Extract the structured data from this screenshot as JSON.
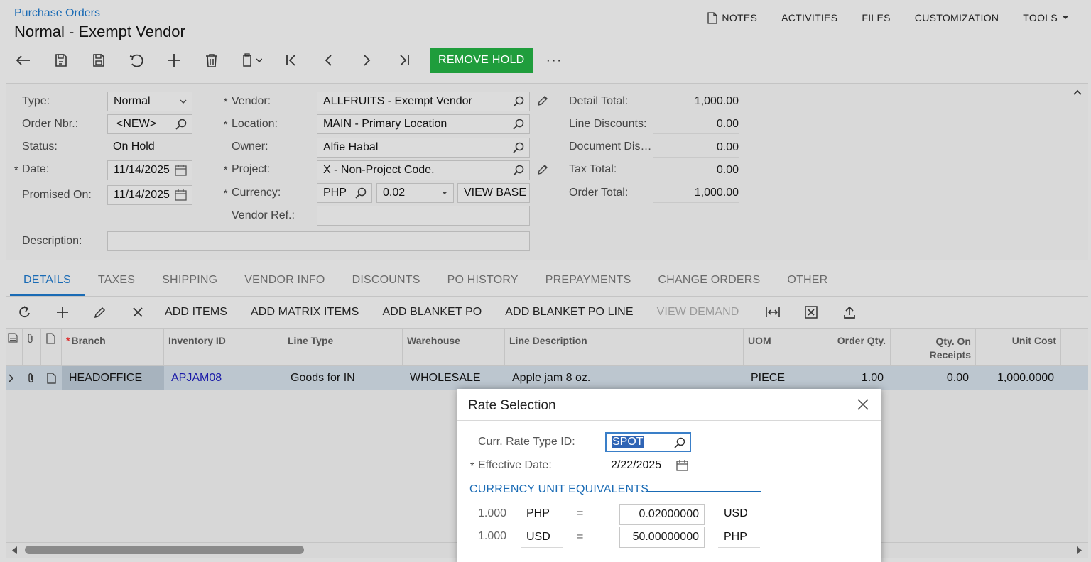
{
  "header": {
    "breadcrumb": "Purchase Orders",
    "title": "Normal - Exempt Vendor",
    "links": [
      "NOTES",
      "ACTIVITIES",
      "FILES",
      "CUSTOMIZATION",
      "TOOLS"
    ]
  },
  "toolbar": {
    "remove_hold": "REMOVE HOLD",
    "more": "···"
  },
  "form": {
    "type_label": "Type:",
    "type_value": "Normal",
    "order_nbr_label": "Order Nbr.:",
    "order_nbr_value": "<NEW>",
    "status_label": "Status:",
    "status_value": "On Hold",
    "date_label": "Date:",
    "date_value": "11/14/2025",
    "promised_label": "Promised On:",
    "promised_value": "11/14/2025",
    "description_label": "Description:",
    "description_value": "",
    "vendor_label": "Vendor:",
    "vendor_value": "ALLFRUITS - Exempt Vendor",
    "location_label": "Location:",
    "location_value": "MAIN - Primary Location",
    "owner_label": "Owner:",
    "owner_value": "Alfie Habal",
    "project_label": "Project:",
    "project_value": "X - Non-Project Code.",
    "currency_label": "Currency:",
    "currency_value": "PHP",
    "rate_value": "0.02",
    "view_base": "VIEW BASE",
    "vendor_ref_label": "Vendor Ref.:",
    "vendor_ref_value": ""
  },
  "totals": {
    "detail_total_label": "Detail Total:",
    "detail_total": "1,000.00",
    "line_discounts_label": "Line Discounts:",
    "line_discounts": "0.00",
    "document_dis_label": "Document Dis…",
    "document_dis": "0.00",
    "tax_total_label": "Tax Total:",
    "tax_total": "0.00",
    "order_total_label": "Order Total:",
    "order_total": "1,000.00"
  },
  "tabs": [
    "DETAILS",
    "TAXES",
    "SHIPPING",
    "VENDOR INFO",
    "DISCOUNTS",
    "PO HISTORY",
    "PREPAYMENTS",
    "CHANGE ORDERS",
    "OTHER"
  ],
  "grid_toolbar": {
    "add_items": "ADD ITEMS",
    "add_matrix_items": "ADD MATRIX ITEMS",
    "add_blanket_po": "ADD BLANKET PO",
    "add_blanket_po_line": "ADD BLANKET PO LINE",
    "view_demand": "VIEW DEMAND"
  },
  "grid": {
    "columns": {
      "branch": "Branch",
      "inventory_id": "Inventory ID",
      "line_type": "Line Type",
      "warehouse": "Warehouse",
      "line_description": "Line Description",
      "uom": "UOM",
      "order_qty": "Order Qty.",
      "qty_on_receipts_1": "Qty. On",
      "qty_on_receipts_2": "Receipts",
      "unit_cost": "Unit Cost"
    },
    "rows": [
      {
        "branch": "HEADOFFICE",
        "inventory_id": "APJAM08",
        "line_type": "Goods for IN",
        "warehouse": "WHOLESALE",
        "line_description": "Apple jam 8 oz.",
        "uom": "PIECE",
        "order_qty": "1.00",
        "qty_on_receipts": "0.00",
        "unit_cost": "1,000.0000"
      }
    ]
  },
  "dialog": {
    "title": "Rate Selection",
    "rate_type_label": "Curr. Rate Type ID:",
    "rate_type_value": "SPOT",
    "effective_date_label": "Effective Date:",
    "effective_date_value": "2/22/2025",
    "section_title": "CURRENCY UNIT EQUIVALENTS",
    "rows": [
      {
        "qty": "1.000",
        "from": "PHP",
        "eq": "=",
        "rate": "0.02000000",
        "to": "USD"
      },
      {
        "qty": "1.000",
        "from": "USD",
        "eq": "=",
        "rate": "50.00000000",
        "to": "PHP"
      }
    ]
  }
}
